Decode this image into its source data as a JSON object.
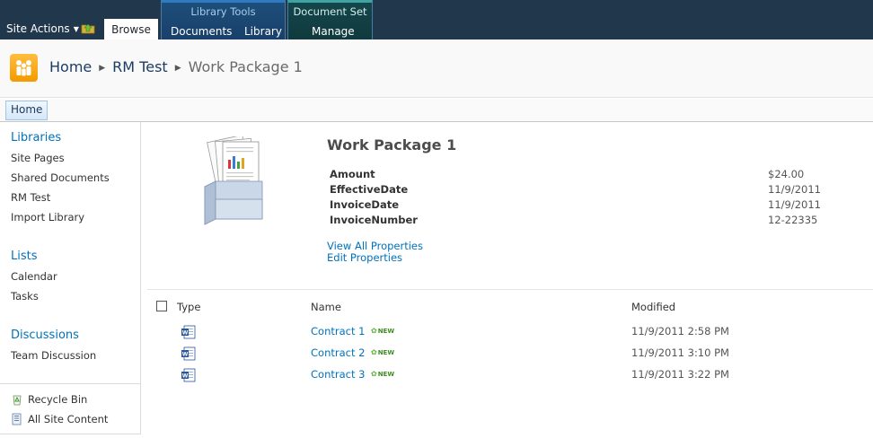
{
  "ribbon": {
    "site_actions": "Site Actions",
    "browse_tab": "Browse",
    "library_tools": {
      "title": "Library Tools",
      "tabs": [
        "Documents",
        "Library"
      ]
    },
    "document_set": {
      "title": "Document Set",
      "tabs": [
        "Manage"
      ]
    }
  },
  "breadcrumb": [
    "Home",
    "RM Test",
    "Work Package 1"
  ],
  "topnav": {
    "home": "Home"
  },
  "leftnav": {
    "libraries": {
      "heading": "Libraries",
      "items": [
        "Site Pages",
        "Shared Documents",
        "RM Test",
        "Import Library"
      ]
    },
    "lists": {
      "heading": "Lists",
      "items": [
        "Calendar",
        "Tasks"
      ]
    },
    "discussions": {
      "heading": "Discussions",
      "items": [
        "Team Discussion"
      ]
    },
    "utilities": [
      "Recycle Bin",
      "All Site Content"
    ]
  },
  "docset": {
    "title": "Work Package 1",
    "properties": [
      {
        "label": "Amount",
        "value": "$24.00"
      },
      {
        "label": "EffectiveDate",
        "value": "11/9/2011"
      },
      {
        "label": "InvoiceDate",
        "value": "11/9/2011"
      },
      {
        "label": "InvoiceNumber",
        "value": "12-22335"
      }
    ],
    "view_all": "View All Properties",
    "edit": "Edit Properties"
  },
  "list": {
    "columns": {
      "type": "Type",
      "name": "Name",
      "modified": "Modified"
    },
    "new_badge": "NEW",
    "rows": [
      {
        "name": "Contract 1",
        "modified": "11/9/2011 2:58 PM"
      },
      {
        "name": "Contract 2",
        "modified": "11/9/2011 3:10 PM"
      },
      {
        "name": "Contract 3",
        "modified": "11/9/2011 3:22 PM"
      }
    ]
  },
  "icons": {
    "site_logo": "people-logo-icon",
    "navigate_up": "folder-up-icon",
    "doc_type": "word-document-icon",
    "recycle_bin": "recycle-bin-icon",
    "site_content": "site-content-icon"
  },
  "colors": {
    "ribbon_bg": "#21374c",
    "link": "#0072bc",
    "logo": "#f39a00",
    "new_badge": "#3e8d23"
  }
}
